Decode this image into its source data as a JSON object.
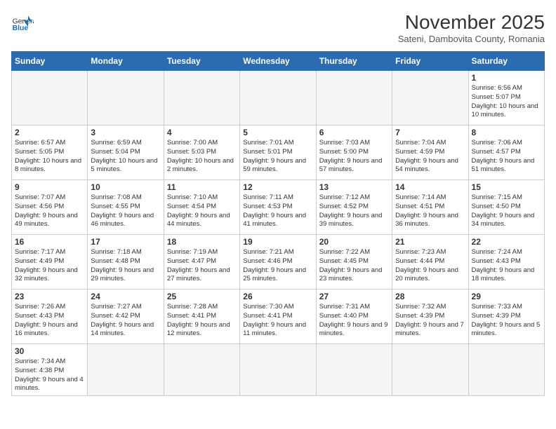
{
  "header": {
    "logo_general": "General",
    "logo_blue": "Blue",
    "month_year": "November 2025",
    "location": "Sateni, Dambovita County, Romania"
  },
  "days_of_week": [
    "Sunday",
    "Monday",
    "Tuesday",
    "Wednesday",
    "Thursday",
    "Friday",
    "Saturday"
  ],
  "weeks": [
    [
      {
        "day": "",
        "empty": true
      },
      {
        "day": "",
        "empty": true
      },
      {
        "day": "",
        "empty": true
      },
      {
        "day": "",
        "empty": true
      },
      {
        "day": "",
        "empty": true
      },
      {
        "day": "",
        "empty": true
      },
      {
        "day": "1",
        "sunrise": "6:56 AM",
        "sunset": "5:07 PM",
        "daylight": "10 hours and 10 minutes."
      }
    ],
    [
      {
        "day": "2",
        "sunrise": "6:57 AM",
        "sunset": "5:05 PM",
        "daylight": "10 hours and 8 minutes."
      },
      {
        "day": "3",
        "sunrise": "6:59 AM",
        "sunset": "5:04 PM",
        "daylight": "10 hours and 5 minutes."
      },
      {
        "day": "4",
        "sunrise": "7:00 AM",
        "sunset": "5:03 PM",
        "daylight": "10 hours and 2 minutes."
      },
      {
        "day": "5",
        "sunrise": "7:01 AM",
        "sunset": "5:01 PM",
        "daylight": "9 hours and 59 minutes."
      },
      {
        "day": "6",
        "sunrise": "7:03 AM",
        "sunset": "5:00 PM",
        "daylight": "9 hours and 57 minutes."
      },
      {
        "day": "7",
        "sunrise": "7:04 AM",
        "sunset": "4:59 PM",
        "daylight": "9 hours and 54 minutes."
      },
      {
        "day": "8",
        "sunrise": "7:06 AM",
        "sunset": "4:57 PM",
        "daylight": "9 hours and 51 minutes."
      }
    ],
    [
      {
        "day": "9",
        "sunrise": "7:07 AM",
        "sunset": "4:56 PM",
        "daylight": "9 hours and 49 minutes."
      },
      {
        "day": "10",
        "sunrise": "7:08 AM",
        "sunset": "4:55 PM",
        "daylight": "9 hours and 46 minutes."
      },
      {
        "day": "11",
        "sunrise": "7:10 AM",
        "sunset": "4:54 PM",
        "daylight": "9 hours and 44 minutes."
      },
      {
        "day": "12",
        "sunrise": "7:11 AM",
        "sunset": "4:53 PM",
        "daylight": "9 hours and 41 minutes."
      },
      {
        "day": "13",
        "sunrise": "7:12 AM",
        "sunset": "4:52 PM",
        "daylight": "9 hours and 39 minutes."
      },
      {
        "day": "14",
        "sunrise": "7:14 AM",
        "sunset": "4:51 PM",
        "daylight": "9 hours and 36 minutes."
      },
      {
        "day": "15",
        "sunrise": "7:15 AM",
        "sunset": "4:50 PM",
        "daylight": "9 hours and 34 minutes."
      }
    ],
    [
      {
        "day": "16",
        "sunrise": "7:17 AM",
        "sunset": "4:49 PM",
        "daylight": "9 hours and 32 minutes."
      },
      {
        "day": "17",
        "sunrise": "7:18 AM",
        "sunset": "4:48 PM",
        "daylight": "9 hours and 29 minutes."
      },
      {
        "day": "18",
        "sunrise": "7:19 AM",
        "sunset": "4:47 PM",
        "daylight": "9 hours and 27 minutes."
      },
      {
        "day": "19",
        "sunrise": "7:21 AM",
        "sunset": "4:46 PM",
        "daylight": "9 hours and 25 minutes."
      },
      {
        "day": "20",
        "sunrise": "7:22 AM",
        "sunset": "4:45 PM",
        "daylight": "9 hours and 23 minutes."
      },
      {
        "day": "21",
        "sunrise": "7:23 AM",
        "sunset": "4:44 PM",
        "daylight": "9 hours and 20 minutes."
      },
      {
        "day": "22",
        "sunrise": "7:24 AM",
        "sunset": "4:43 PM",
        "daylight": "9 hours and 18 minutes."
      }
    ],
    [
      {
        "day": "23",
        "sunrise": "7:26 AM",
        "sunset": "4:43 PM",
        "daylight": "9 hours and 16 minutes."
      },
      {
        "day": "24",
        "sunrise": "7:27 AM",
        "sunset": "4:42 PM",
        "daylight": "9 hours and 14 minutes."
      },
      {
        "day": "25",
        "sunrise": "7:28 AM",
        "sunset": "4:41 PM",
        "daylight": "9 hours and 12 minutes."
      },
      {
        "day": "26",
        "sunrise": "7:30 AM",
        "sunset": "4:41 PM",
        "daylight": "9 hours and 11 minutes."
      },
      {
        "day": "27",
        "sunrise": "7:31 AM",
        "sunset": "4:40 PM",
        "daylight": "9 hours and 9 minutes."
      },
      {
        "day": "28",
        "sunrise": "7:32 AM",
        "sunset": "4:39 PM",
        "daylight": "9 hours and 7 minutes."
      },
      {
        "day": "29",
        "sunrise": "7:33 AM",
        "sunset": "4:39 PM",
        "daylight": "9 hours and 5 minutes."
      }
    ],
    [
      {
        "day": "30",
        "sunrise": "7:34 AM",
        "sunset": "4:38 PM",
        "daylight": "9 hours and 4 minutes."
      },
      {
        "day": "",
        "empty": true
      },
      {
        "day": "",
        "empty": true
      },
      {
        "day": "",
        "empty": true
      },
      {
        "day": "",
        "empty": true
      },
      {
        "day": "",
        "empty": true
      },
      {
        "day": "",
        "empty": true
      }
    ]
  ]
}
